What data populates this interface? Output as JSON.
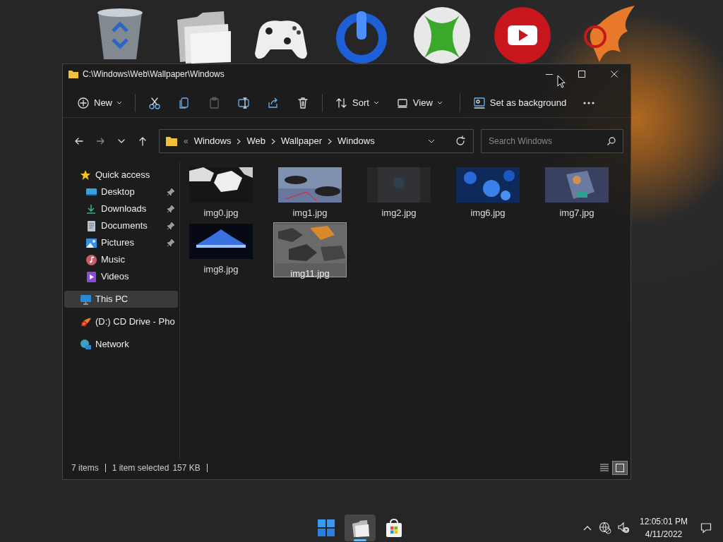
{
  "window": {
    "title": "C:\\Windows\\Web\\Wallpaper\\Windows"
  },
  "toolbar": [
    {
      "kind": "new",
      "label": "New",
      "disabled": false
    },
    {
      "kind": "cut",
      "disabled": false
    },
    {
      "kind": "copy",
      "disabled": false
    },
    {
      "kind": "paste",
      "disabled": true
    },
    {
      "kind": "rename",
      "disabled": false
    },
    {
      "kind": "share",
      "disabled": false
    },
    {
      "kind": "delete",
      "disabled": false
    },
    {
      "kind": "sort",
      "label": "Sort",
      "disabled": false
    },
    {
      "kind": "view",
      "label": "View",
      "disabled": false
    },
    {
      "kind": "background",
      "label": "Set as background",
      "disabled": false
    },
    {
      "kind": "more",
      "disabled": false
    }
  ],
  "address": {
    "overflow": "«",
    "crumbs": [
      "Windows",
      "Web",
      "Wallpaper",
      "Windows"
    ]
  },
  "search": {
    "placeholder": "Search Windows"
  },
  "sidebar": {
    "items": [
      {
        "kind": "star",
        "label": "Quick access",
        "selected": false,
        "children": [
          {
            "kind": "desktop",
            "label": "Desktop",
            "pinned": true,
            "selected": false
          },
          {
            "kind": "downloads",
            "label": "Downloads",
            "pinned": true,
            "selected": false
          },
          {
            "kind": "documents",
            "label": "Documents",
            "pinned": true,
            "selected": false
          },
          {
            "kind": "pictures",
            "label": "Pictures",
            "pinned": true,
            "selected": false
          },
          {
            "kind": "music",
            "label": "Music",
            "pinned": false,
            "selected": false
          },
          {
            "kind": "videos",
            "label": "Videos",
            "pinned": false,
            "selected": false
          }
        ]
      },
      {
        "kind": "pc",
        "label": "This PC",
        "selected": true
      },
      {
        "kind": "cd",
        "label": "(D:) CD Drive - Pho",
        "selected": false
      },
      {
        "kind": "network",
        "label": "Network",
        "selected": false
      }
    ]
  },
  "files": [
    {
      "name": "img0.jpg",
      "selected": false
    },
    {
      "name": "img1.jpg",
      "selected": false
    },
    {
      "name": "img2.jpg",
      "selected": false
    },
    {
      "name": "img6.jpg",
      "selected": false
    },
    {
      "name": "img7.jpg",
      "selected": false
    },
    {
      "name": "img8.jpg",
      "selected": false
    },
    {
      "name": "img11.jpg",
      "selected": true
    }
  ],
  "status_bar": {
    "count": "7 items",
    "selection": "1 item selected",
    "size": "157 KB",
    "views": [
      {
        "kind": "details",
        "selected": false
      },
      {
        "kind": "tiles",
        "selected": true
      }
    ]
  },
  "taskbar": {
    "apps": [
      {
        "kind": "start",
        "active": false
      },
      {
        "kind": "explorer",
        "active": true
      },
      {
        "kind": "store",
        "active": false
      }
    ],
    "clock": {
      "time": "12:05:01 PM",
      "date": "4/11/2022"
    }
  }
}
